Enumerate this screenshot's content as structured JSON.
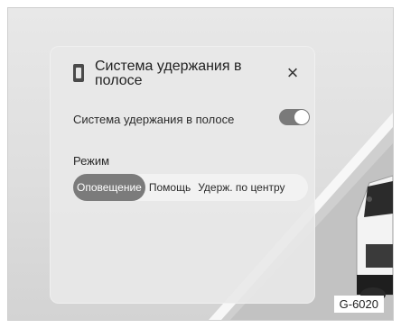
{
  "panel": {
    "title": "Система удержания в полосе",
    "close_icon": "close-icon",
    "lane_icon": "lane-keeping-icon"
  },
  "setting": {
    "label": "Система удержания в полосе",
    "toggle_on": true
  },
  "mode": {
    "label": "Режим",
    "options": [
      "Оповещение",
      "Помощь",
      "Удерж. по центру"
    ],
    "selected": "Оповещение"
  },
  "figure_code": "G-6020",
  "colors": {
    "panel_bg": "#e8e8e8",
    "active_segment": "#7b7b7b",
    "toggle_on": "#7a7a7a"
  }
}
